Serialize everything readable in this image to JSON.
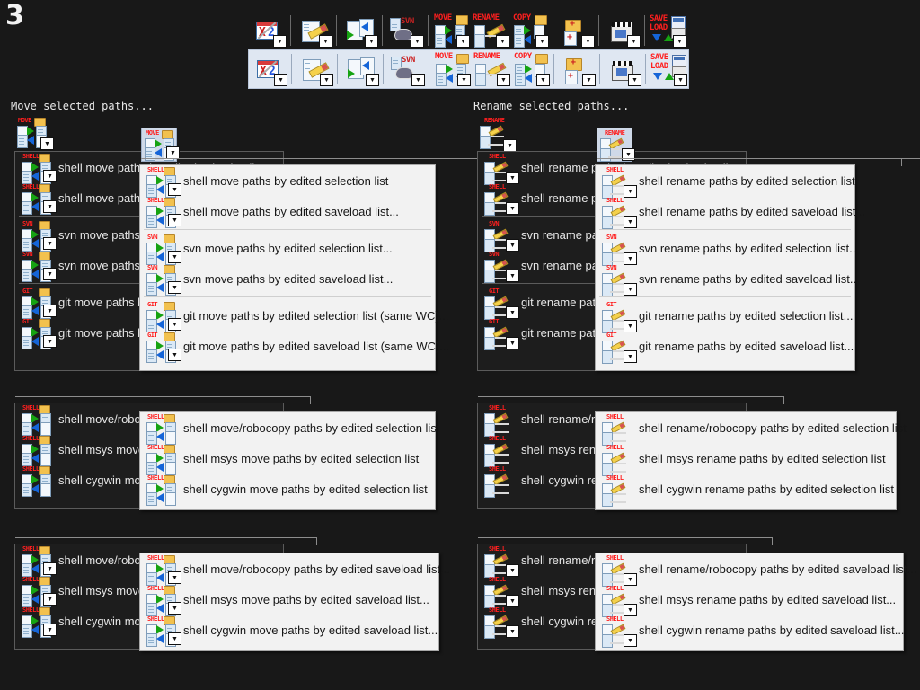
{
  "page": {
    "index_label": "3"
  },
  "toolbar": {
    "rows": [
      {
        "name": "toolbar-row-normal",
        "state": "normal"
      },
      {
        "name": "toolbar-row-hover",
        "state": "highlighted"
      }
    ],
    "buttons": [
      {
        "name": "clear-selection-x2-button",
        "icon": "calendar-x2-icon",
        "tag": "X·2"
      },
      {
        "name": "edit-list-button",
        "icon": "notepad-pencil-icon",
        "tag": ""
      },
      {
        "name": "move-copy-arrows-button",
        "icon": "document-arrows-icon",
        "tag": ""
      },
      {
        "name": "svn-button",
        "icon": "svn-turtle-icon",
        "tag": "SVN"
      },
      {
        "name": "move-button",
        "icon": "move-icon",
        "tag": "MOVE"
      },
      {
        "name": "rename-button",
        "icon": "rename-icon",
        "tag": "RENAME"
      },
      {
        "name": "copy-button",
        "icon": "copy-icon",
        "tag": "COPY"
      },
      {
        "name": "new-folder-file-button",
        "icon": "new-folder-plus-icon",
        "tag": ""
      },
      {
        "name": "media-button",
        "icon": "clapperboard-icon",
        "tag": ""
      },
      {
        "name": "save-load-button",
        "icon": "save-load-icon",
        "tag": "SAVE LOAD"
      }
    ]
  },
  "sections": [
    {
      "id": "move-selected-paths",
      "title": "Move selected paths...",
      "parent_icon": "move-icon",
      "items": [
        {
          "tag": "SHELL",
          "icon": "shell-move-icon",
          "label": "shell move paths by edited selection list",
          "submenu": true
        },
        {
          "tag": "SHELL",
          "icon": "shell-move-icon",
          "label": "shell move paths by edited saveload list...",
          "submenu": true
        },
        {
          "separator": true
        },
        {
          "tag": "SVN",
          "icon": "svn-move-icon",
          "label": "svn move paths by edited selection list...",
          "submenu": true
        },
        {
          "tag": "SVN",
          "icon": "svn-move-icon",
          "label": "svn move paths by edited saveload list...",
          "submenu": true
        },
        {
          "separator": true
        },
        {
          "tag": "GIT",
          "icon": "git-move-icon",
          "label": "git move paths by edited selection list (same WC)...",
          "submenu": true
        },
        {
          "tag": "GIT",
          "icon": "git-move-icon",
          "label": "git move paths by edited saveload list (same WC)...",
          "submenu": true
        }
      ]
    },
    {
      "id": "rename-selected-paths",
      "title": "Rename selected paths...",
      "parent_icon": "rename-icon",
      "items": [
        {
          "tag": "SHELL",
          "icon": "shell-rename-icon",
          "label": "shell rename paths by edited selection list",
          "submenu": true
        },
        {
          "tag": "SHELL",
          "icon": "shell-rename-icon",
          "label": "shell rename paths by edited saveload list...",
          "submenu": true
        },
        {
          "separator": true
        },
        {
          "tag": "SVN",
          "icon": "svn-rename-icon",
          "label": "svn rename paths by edited selection list...",
          "submenu": true
        },
        {
          "tag": "SVN",
          "icon": "svn-rename-icon",
          "label": "svn rename paths by edited saveload list...",
          "submenu": true
        },
        {
          "separator": true
        },
        {
          "tag": "GIT",
          "icon": "git-rename-icon",
          "label": "git rename paths by edited selection list...",
          "submenu": true
        },
        {
          "tag": "GIT",
          "icon": "git-rename-icon",
          "label": "git rename paths by edited saveload list...",
          "submenu": true
        }
      ]
    },
    {
      "id": "move-variants-selection",
      "title": "",
      "items": [
        {
          "tag": "SHELL",
          "icon": "shell-move-icon",
          "label": "shell move/robocopy paths by edited selection list",
          "submenu": false
        },
        {
          "tag": "SHELL",
          "icon": "shell-move-icon",
          "label": "shell msys move paths by edited selection list",
          "submenu": false
        },
        {
          "tag": "SHELL",
          "icon": "shell-move-icon",
          "label": "shell cygwin move paths by edited selection list",
          "submenu": false
        }
      ]
    },
    {
      "id": "rename-variants-selection",
      "title": "",
      "items": [
        {
          "tag": "SHELL",
          "icon": "shell-rename-icon",
          "label": "shell rename/robocopy paths by edited selection list",
          "submenu": false
        },
        {
          "tag": "SHELL",
          "icon": "shell-rename-icon",
          "label": "shell msys rename paths by edited selection list",
          "submenu": false
        },
        {
          "tag": "SHELL",
          "icon": "shell-rename-icon",
          "label": "shell cygwin rename paths by edited selection list",
          "submenu": false
        }
      ]
    },
    {
      "id": "move-variants-saveload",
      "title": "",
      "items": [
        {
          "tag": "SHELL",
          "icon": "shell-move-icon",
          "label": "shell move/robocopy paths by edited saveload list...",
          "submenu": true
        },
        {
          "tag": "SHELL",
          "icon": "shell-move-icon",
          "label": "shell msys move paths by edited saveload list...",
          "submenu": true
        },
        {
          "tag": "SHELL",
          "icon": "shell-move-icon",
          "label": "shell cygwin move paths by edited saveload list...",
          "submenu": true
        }
      ]
    },
    {
      "id": "rename-variants-saveload",
      "title": "",
      "items": [
        {
          "tag": "SHELL",
          "icon": "shell-rename-icon",
          "label": "shell rename/robocopy paths by edited saveload list...",
          "submenu": true
        },
        {
          "tag": "SHELL",
          "icon": "shell-rename-icon",
          "label": "shell msys rename paths by edited saveload list...",
          "submenu": true
        },
        {
          "tag": "SHELL",
          "icon": "shell-rename-icon",
          "label": "shell cygwin rename paths by edited saveload list...",
          "submenu": true
        }
      ]
    }
  ],
  "colors": {
    "background": "#181818",
    "dark_menu_bg": "#1d1d1d",
    "light_menu_bg": "#f2f2f2",
    "tag_red": "#ff1f1f",
    "arrow_green": "#16a312",
    "arrow_blue": "#1565d8",
    "toolbar_highlight": "#dfe7f2"
  }
}
